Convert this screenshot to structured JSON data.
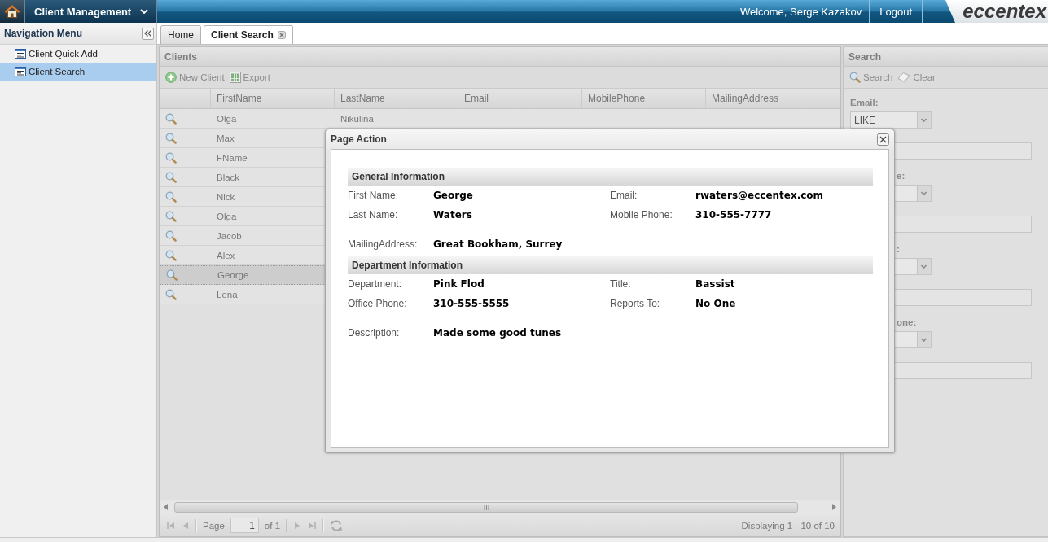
{
  "top_bar": {
    "module_menu": "Client Management",
    "welcome": "Welcome, Serge Kazakov",
    "logout": "Logout",
    "logo": "eccentex"
  },
  "navigation": {
    "title": "Navigation Menu",
    "items": [
      {
        "label": "Client Quick Add",
        "selected": false
      },
      {
        "label": "Client Search",
        "selected": true
      }
    ]
  },
  "tabs": [
    {
      "label": "Home",
      "selected": false,
      "closable": false
    },
    {
      "label": "Client Search",
      "selected": true,
      "closable": true
    }
  ],
  "clients_panel": {
    "title": "Clients",
    "toolbar": [
      {
        "label": "New Client",
        "kind": "add"
      },
      {
        "label": "Export",
        "kind": "export"
      }
    ],
    "columns": [
      "FirstName",
      "LastName",
      "Email",
      "MobilePhone",
      "MailingAddress"
    ],
    "rows": [
      {
        "cells": [
          "Olga",
          "Nikulina"
        ],
        "selected": false
      },
      {
        "cells": [
          "Max"
        ],
        "selected": false
      },
      {
        "cells": [
          "FName"
        ],
        "selected": false
      },
      {
        "cells": [
          "Black"
        ],
        "selected": false
      },
      {
        "cells": [
          "Nick"
        ],
        "selected": false
      },
      {
        "cells": [
          "Olga"
        ],
        "selected": false
      },
      {
        "cells": [
          "Jacob"
        ],
        "selected": false
      },
      {
        "cells": [
          "Alex"
        ],
        "selected": false
      },
      {
        "cells": [
          "George"
        ],
        "selected": true
      },
      {
        "cells": [
          "Lena"
        ],
        "selected": false
      }
    ],
    "pager": {
      "page_label": "Page",
      "page": "1",
      "page_count": "of 1",
      "summary": "Displaying 1 - 10 of 10"
    }
  },
  "search_panel": {
    "title": "Search",
    "toolbar": [
      {
        "label": "Search",
        "kind": "search"
      },
      {
        "label": "Clear",
        "kind": "clear"
      }
    ],
    "fields": [
      {
        "label": "Email:",
        "kind": "full",
        "operator": "LIKE"
      },
      {
        "label": "e:",
        "kind": "clipped"
      },
      {
        "label": ":",
        "kind": "clipped"
      },
      {
        "label": "one:",
        "kind": "clipped"
      }
    ]
  },
  "dialog": {
    "title": "Page Action",
    "sections": [
      {
        "title": "General Information",
        "rows": [
          [
            {
              "label": "First Name:",
              "value": "George"
            },
            {
              "label": "Email:",
              "value": "rwaters@eccentex.com"
            }
          ],
          [
            {
              "label": "Last Name:",
              "value": "Waters"
            },
            {
              "label": "Mobile Phone:",
              "value": "310-555-7777"
            }
          ],
          [
            {
              "label": "MailingAddress:",
              "value": "Great Bookham, Surrey"
            }
          ]
        ]
      },
      {
        "title": "Department Information",
        "rows": [
          [
            {
              "label": "Department:",
              "value": "Pink Flod"
            },
            {
              "label": "Title:",
              "value": "Bassist"
            }
          ],
          [
            {
              "label": "Office Phone:",
              "value": "310-555-5555"
            },
            {
              "label": "Reports To:",
              "value": "No One"
            }
          ],
          [
            {
              "label": "Description:",
              "value": "Made some good tunes"
            }
          ]
        ]
      }
    ]
  }
}
